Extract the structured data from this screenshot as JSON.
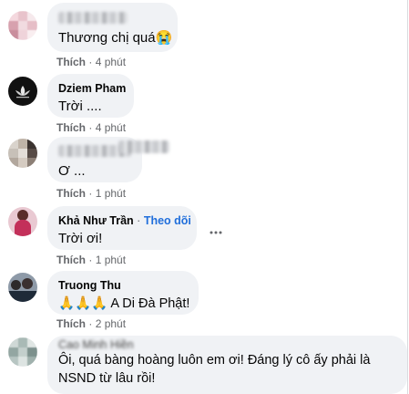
{
  "comments": [
    {
      "author": "",
      "text": "Thương chị quá😭",
      "like_label": "Thích",
      "time": "4 phút"
    },
    {
      "author": "Dziem Pham",
      "text": "Trời ....",
      "like_label": "Thích",
      "time": "4 phút"
    },
    {
      "author": "",
      "text": "Ơ ...",
      "like_label": "Thích",
      "time": "1 phút"
    },
    {
      "author": "Khả Như Trần",
      "follow_label": "Theo dõi",
      "text": "Trời ơi!",
      "like_label": "Thích",
      "time": "1 phút"
    },
    {
      "author": "Truong Thu",
      "text": "🙏🙏🙏 A Di Đà Phật!",
      "like_label": "Thích",
      "time": "2 phút"
    },
    {
      "author": "Cao Minh Hiền",
      "text_line1": "Ôi, quá bàng hoàng luôn em ơi! Đáng lý cô ấy phải là",
      "text_line2": "NSND từ lâu rồi!"
    }
  ],
  "separator": "·",
  "more_icon": "more-horizontal-icon",
  "colors": {
    "bubble": "#f0f2f5",
    "meta": "#65676b",
    "follow": "#216fdb"
  }
}
